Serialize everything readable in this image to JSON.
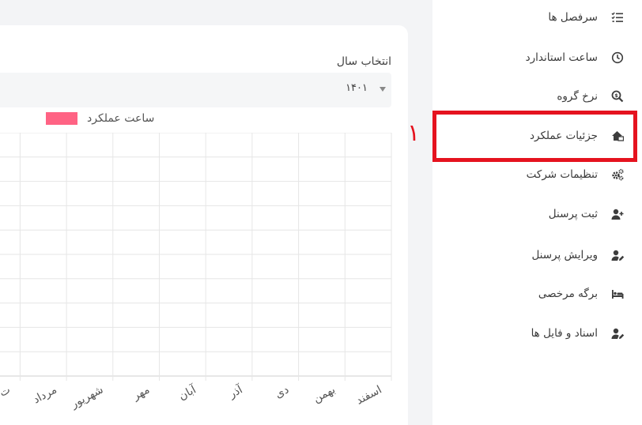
{
  "filter": {
    "label": "انتخاب سال",
    "value": "۱۴۰۱"
  },
  "sidebar": {
    "items": [
      {
        "label": "سرفصل ها",
        "icon": "tasks-list-icon"
      },
      {
        "label": "ساعت استاندارد",
        "icon": "clock-icon"
      },
      {
        "label": "نرخ گروه",
        "icon": "dollar-search-icon"
      },
      {
        "label": "جزئیات عملکرد",
        "icon": "house-chart-icon"
      },
      {
        "label": "تنظیمات شرکت",
        "icon": "gears-icon"
      },
      {
        "label": "ثبت پرسنل",
        "icon": "user-plus-icon"
      },
      {
        "label": "ویرایش پرسنل",
        "icon": "user-edit-icon"
      },
      {
        "label": "برگه مرخصی",
        "icon": "bed-icon"
      },
      {
        "label": "اسناد و فایل ها",
        "icon": "user-edit-icon"
      }
    ],
    "active_index": 3
  },
  "annotation": {
    "marker": "۱",
    "color": "#e5131f"
  },
  "chart_data": {
    "type": "bar",
    "legend_position": "top",
    "grid": true,
    "series": [
      {
        "name": "ساعت عملکرد",
        "color": "#ff6384",
        "values": []
      }
    ],
    "categories": [
      "اسفند",
      "بهمن",
      "دی",
      "آذر",
      "آبان",
      "مهر",
      "شهریور",
      "مرداد"
    ],
    "partial_category_marker": "ت"
  }
}
